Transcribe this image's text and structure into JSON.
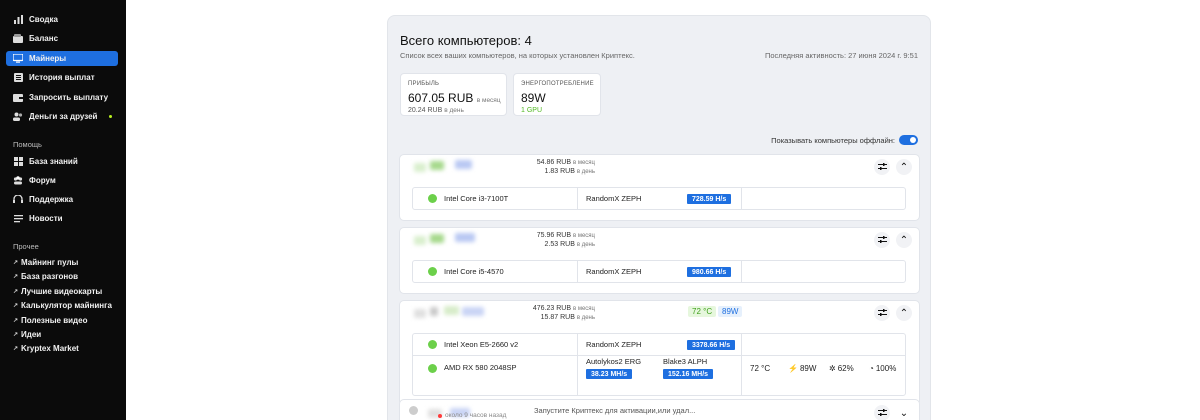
{
  "sidebar": {
    "nav": [
      {
        "label": "Сводка",
        "icon": "chart-icon"
      },
      {
        "label": "Баланс",
        "icon": "wallet-icon"
      },
      {
        "label": "Майнеры",
        "icon": "monitor-icon"
      },
      {
        "label": "История выплат",
        "icon": "list-icon"
      },
      {
        "label": "Запросить выплату",
        "icon": "wallet-out-icon"
      },
      {
        "label": "Деньги за друзей",
        "icon": "users-icon"
      }
    ],
    "help_title": "Помощь",
    "help": [
      {
        "label": "База знаний",
        "icon": "book-icon"
      },
      {
        "label": "Форум",
        "icon": "forum-icon"
      },
      {
        "label": "Поддержка",
        "icon": "headset-icon"
      },
      {
        "label": "Новости",
        "icon": "news-icon"
      }
    ],
    "other_title": "Прочее",
    "other": [
      {
        "label": "Майнинг пулы"
      },
      {
        "label": "База разгонов"
      },
      {
        "label": "Лучшие видеокарты"
      },
      {
        "label": "Калькулятор майнинга"
      },
      {
        "label": "Полезные видео"
      },
      {
        "label": "Идеи"
      },
      {
        "label": "Kryptex Market"
      }
    ],
    "accent": "#1e6fe0"
  },
  "main": {
    "title": "Всего компьютеров: 4",
    "subtitle": "Список всех ваших компьютеров, на которых установлен Криптекс.",
    "last_active": "Последняя активность: 27 июня 2024 г. 9:51",
    "profit_card": {
      "label": "ПРИБЫЛЬ",
      "value": "607.05 RUB",
      "per_month": "в месяц",
      "day_value": "20.24 RUB",
      "per_day": "в день"
    },
    "power_card": {
      "label": "ЭНЕРГОПОТРЕБЛЕНИЕ",
      "value": "89W",
      "sub": "1 GPU"
    },
    "offline_toggle_label": "Показывать компьютеры оффлайн:"
  },
  "rigs": [
    {
      "month": "54.86 RUB",
      "day": "1.83 RUB",
      "per_month": "в месяц",
      "per_day": "в день",
      "devices": [
        {
          "name": "Intel Core i3-7100T",
          "algo": "RandomX ZEPH",
          "hash": "728.59 H/s"
        }
      ]
    },
    {
      "month": "75.96 RUB",
      "day": "2.53 RUB",
      "per_month": "в месяц",
      "per_day": "в день",
      "devices": [
        {
          "name": "Intel Core i5-4570",
          "algo": "RandomX ZEPH",
          "hash": "980.66 H/s"
        }
      ]
    },
    {
      "month": "476.23 RUB",
      "day": "15.87 RUB",
      "per_month": "в месяц",
      "per_day": "в день",
      "temp": "72 °C",
      "power": "89W",
      "devices": [
        {
          "name": "Intel Xeon E5-2660 v2",
          "algo": "RandomX ZEPH",
          "hash": "3378.66 H/s"
        },
        {
          "name": "AMD RX 580 2048SP",
          "algo": "Autolykos2 ERG",
          "hash": "38.23 MH/s",
          "algo2": "Blake3 ALPH",
          "hash2": "152.16 MH/s",
          "temp": "72 °C",
          "power": "89W",
          "fan": "62%",
          "load": "100%"
        }
      ]
    }
  ],
  "offline_rig": {
    "time": "около 9 часов назад",
    "message": "Запустите Криптекс для активации,или удал..."
  }
}
